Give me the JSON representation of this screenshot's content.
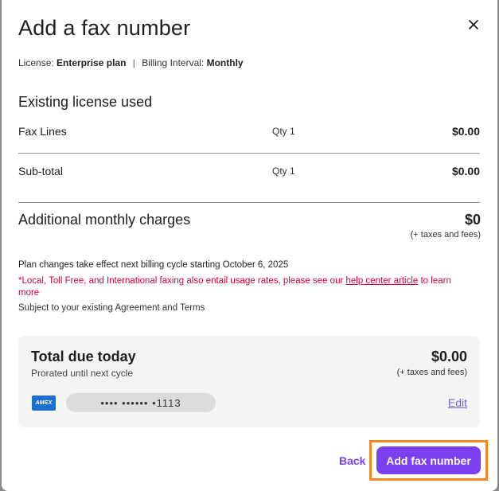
{
  "dialog": {
    "title": "Add a fax number",
    "close_icon": "close-icon"
  },
  "license": {
    "license_label": "License:",
    "license_value": "Enterprise plan",
    "separator": "|",
    "billing_label": "Billing Interval:",
    "billing_value": "Monthly"
  },
  "existing": {
    "title": "Existing license used",
    "rows": [
      {
        "label": "Fax Lines",
        "qty": "Qty 1",
        "amount": "$0.00"
      },
      {
        "label": "Sub-total",
        "qty": "Qty 1",
        "amount": "$0.00"
      }
    ]
  },
  "additional": {
    "title": "Additional monthly charges",
    "amount": "$0",
    "tax_note": "(+ taxes and fees)"
  },
  "notes": {
    "plan_change": "Plan changes take effect next billing cycle starting October 6, 2025",
    "warn_prefix": "*Local, Toll Free, and International faxing also entail usage rates, please see our ",
    "warn_link": "help center article",
    "warn_suffix": " to learn more",
    "agreement": "Subject to your existing Agreement and Terms"
  },
  "total": {
    "title": "Total due today",
    "amount": "$0.00",
    "prorated": "Prorated until next cycle",
    "tax_note": "(+ taxes and fees)",
    "card_brand": "AMEX",
    "card_icon": "amex-card-icon",
    "card_number": "•••• •••••• •1113",
    "edit_label": "Edit"
  },
  "actions": {
    "back_label": "Back",
    "primary_label": "Add fax number"
  },
  "colors": {
    "accent": "#7b3ff2",
    "warning_text": "#d6003b",
    "highlight_outline": "#f58a25",
    "card_background": "#f4f4f4"
  }
}
